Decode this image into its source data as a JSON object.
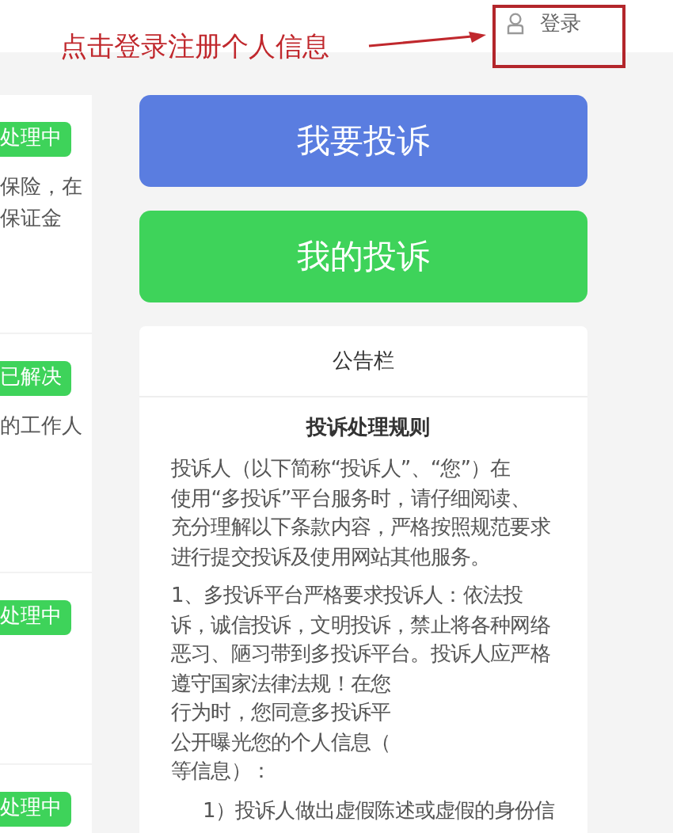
{
  "annotation": {
    "text": "点击登录注册个人信息"
  },
  "header": {
    "login": "登录"
  },
  "complaints": [
    {
      "status": "处理中",
      "lines": [
        "保险，在",
        "保证金"
      ]
    },
    {
      "status": "已解决",
      "lines": [
        "的工作人"
      ]
    },
    {
      "status": "处理中"
    },
    {
      "status": "处理中"
    }
  ],
  "actions": [
    {
      "label": "我要投诉",
      "color": "#5a7de0"
    },
    {
      "label": "我的投诉",
      "color": "#3ed35a"
    }
  ],
  "notice": {
    "title": "公告栏",
    "heading": "投诉处理规则",
    "paragraphs": [
      {
        "lines": [
          "投诉人（以下简称“投诉人”、“您”）在",
          "使用“多投诉”平台服务时，请仔细阅读、",
          "充分理解以下条款内容，严格按照规范要求",
          "进行提交投诉及使用网站其他服务。"
        ]
      },
      {
        "lines": [
          "1、多投诉平台严格要求投诉人：依法投",
          "诉，诚信投诉，文明投诉，禁止将各种网络",
          "恶习、陋习带到多投诉平台。投诉人应严格",
          "遵守国家法律法规！在您",
          "行为时，您同意多投诉平",
          "公开曝光您的个人信息（",
          "等信息）："
        ],
        "children": [
          {
            "lines": [
              "1）投诉人做出虚假陈述或虚假的身份信"
            ]
          }
        ]
      }
    ]
  }
}
